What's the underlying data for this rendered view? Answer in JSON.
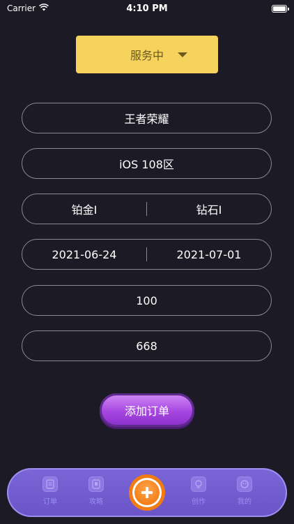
{
  "status_bar": {
    "carrier": "Carrier",
    "time": "4:10 PM"
  },
  "order_status": {
    "selected": "服务中",
    "icon": "caret-down-icon"
  },
  "form": {
    "game": "王者荣耀",
    "server": "iOS 108区",
    "rank_from": "铂金I",
    "rank_to": "钻石I",
    "date_start": "2021-06-24",
    "date_end": "2021-07-01",
    "amount_1": "100",
    "amount_2": "668"
  },
  "add_order_label": "添加订单",
  "tab_bar": {
    "tabs": [
      {
        "label": "订单",
        "icon": "order-icon"
      },
      {
        "label": "攻略",
        "icon": "guide-icon"
      },
      {
        "label": "",
        "icon": "plus-icon"
      },
      {
        "label": "创作",
        "icon": "create-icon"
      },
      {
        "label": "我的",
        "icon": "profile-icon"
      }
    ]
  },
  "colors": {
    "background": "#1c1a24",
    "accent_yellow": "#f5d35d",
    "button_purple": "#a646e0",
    "tab_bar": "#6a54c8",
    "center_orange": "#f27b12"
  }
}
